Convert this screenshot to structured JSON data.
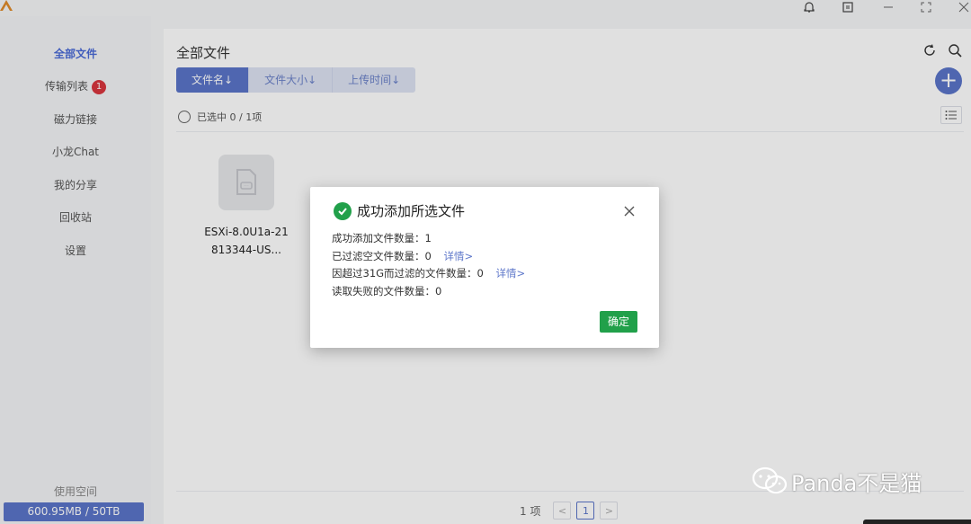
{
  "sidebar": {
    "items": [
      {
        "label": "全部文件"
      },
      {
        "label": "传输列表",
        "badge": "1"
      },
      {
        "label": "磁力链接"
      },
      {
        "label": "小龙Chat"
      },
      {
        "label": "我的分享"
      },
      {
        "label": "回收站"
      },
      {
        "label": "设置"
      }
    ],
    "usage_label": "使用空间",
    "usage_value": "600.95MB / 50TB",
    "usage_fraction": 1.17e-05
  },
  "main": {
    "title": "全部文件",
    "sort_tabs": [
      {
        "label": "文件名↓"
      },
      {
        "label": "文件大小↓"
      },
      {
        "label": "上传时间↓"
      }
    ],
    "selection_text": "已选中 0 / 1项",
    "files": [
      {
        "name": "ESXi-8.0U1a-21813344-US..."
      }
    ],
    "pager": {
      "total": "1 项",
      "current_page": "1"
    }
  },
  "dialog": {
    "title": "成功添加所选文件",
    "lines": [
      {
        "text": "成功添加文件数量：1",
        "link": ""
      },
      {
        "text": "已过滤空文件数量：0",
        "link": "详情>"
      },
      {
        "text": "因超过31G而过滤的文件数量：0",
        "link": "详情>"
      },
      {
        "text": "读取失败的文件数量：0",
        "link": ""
      }
    ],
    "ok_label": "确定"
  },
  "watermark": {
    "text": "Panda不是猫"
  },
  "colors": {
    "accent": "#5b75c9",
    "success": "#21a04a",
    "badge": "#d9363e"
  }
}
